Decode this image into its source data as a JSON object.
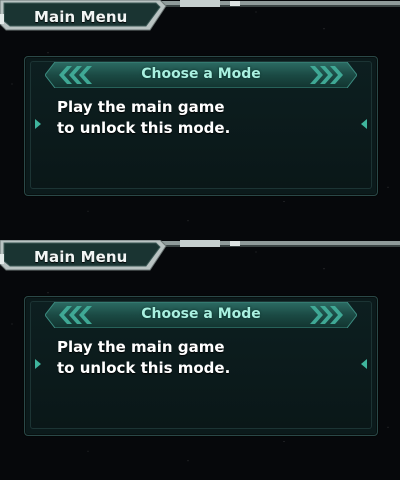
{
  "screens": [
    {
      "menu_tab": {
        "label": "Main Menu"
      },
      "panel": {
        "title": "Choose a Mode",
        "message_line1": "Play the main game",
        "message_line2": "to unlock this mode."
      }
    },
    {
      "menu_tab": {
        "label": "Main Menu"
      },
      "panel": {
        "title": "Choose a Mode",
        "message_line1": "Play the main game",
        "message_line2": "to unlock this mode."
      }
    }
  ],
  "colors": {
    "accent_teal": "#2fae9a",
    "title_text": "#a9f0e0",
    "body_text": "#ffffff",
    "frame_silver": "#b9c3c2"
  },
  "icons": {
    "header_chevrons": "chevron-icon",
    "side_arrows": "triangle-arrow-icon"
  }
}
